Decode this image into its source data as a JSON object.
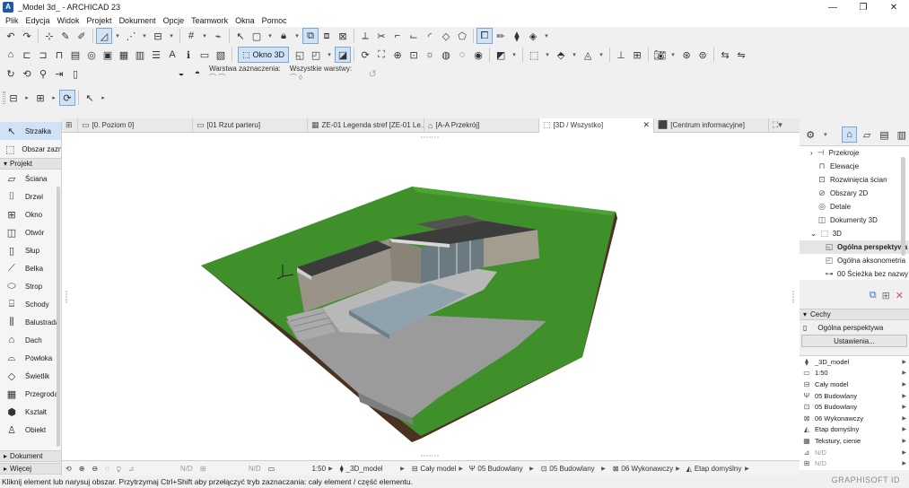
{
  "window": {
    "title": "_Model 3d_ - ARCHICAD 23",
    "app_icon": "archicad-logo"
  },
  "menu": [
    "Plik",
    "Edycja",
    "Widok",
    "Projekt",
    "Dokument",
    "Opcje",
    "Teamwork",
    "Okna",
    "Pomoc"
  ],
  "toolbar": {
    "window3d_label": "Okno 3D"
  },
  "infobox": {
    "layer_sel_label": "Warstwa zaznaczenia:",
    "all_layers_label": "Wszystkie warstwy:"
  },
  "toolbox": {
    "top": [
      {
        "label": "Strzałka",
        "icon": "arrow-icon",
        "selected": true
      },
      {
        "label": "Obszar zazn",
        "icon": "marquee-icon",
        "selected": false
      }
    ],
    "project_header": "Projekt",
    "project_tools": [
      {
        "label": "Ściana",
        "icon": "wall-icon"
      },
      {
        "label": "Drzwi",
        "icon": "door-icon"
      },
      {
        "label": "Okno",
        "icon": "window-icon"
      },
      {
        "label": "Otwór",
        "icon": "opening-icon"
      },
      {
        "label": "Słup",
        "icon": "column-icon"
      },
      {
        "label": "Belka",
        "icon": "beam-icon"
      },
      {
        "label": "Strop",
        "icon": "slab-icon"
      },
      {
        "label": "Schody",
        "icon": "stair-icon"
      },
      {
        "label": "Balustrada",
        "icon": "railing-icon"
      },
      {
        "label": "Dach",
        "icon": "roof-icon"
      },
      {
        "label": "Powłoka",
        "icon": "shell-icon"
      },
      {
        "label": "Świetlik",
        "icon": "skylight-icon"
      },
      {
        "label": "Przegroda",
        "icon": "curtain-wall-icon"
      },
      {
        "label": "Kształt",
        "icon": "morph-icon"
      },
      {
        "label": "Obiekt",
        "icon": "object-icon"
      }
    ],
    "document_header": "Dokument",
    "more_header": "Więcej"
  },
  "tabs": [
    {
      "label": "[0. Poziom 0]",
      "icon": "floorplan-icon",
      "active": false
    },
    {
      "label": "[01 Rzut parteru]",
      "icon": "layout-icon",
      "active": false
    },
    {
      "label": "ZE-01 Legenda stref [ZE-01 Le...",
      "icon": "schedule-icon",
      "active": false
    },
    {
      "label": "[A-A Przekrój]",
      "icon": "section-icon",
      "active": false
    },
    {
      "label": "[3D / Wszystko]",
      "icon": "3d-icon",
      "active": true
    },
    {
      "label": "[Centrum informacyjne]",
      "icon": "info-icon",
      "active": false
    }
  ],
  "viewport_status": {
    "nd1": "N/D",
    "nd2": "N/D",
    "scale": "1:50",
    "layer_combo": "_3D_model",
    "model_view": "Cały model",
    "pen_set": "05 Budowlany",
    "mvo": "05 Budowlany",
    "graphic_override": "06 Wykonawczy",
    "renovation": "Etap domyślny"
  },
  "navigator": {
    "items": [
      {
        "label": "Przekroje",
        "icon": "section-icon",
        "indent": 1,
        "expander": true
      },
      {
        "label": "Elewacje",
        "icon": "elevation-icon",
        "indent": 1
      },
      {
        "label": "Rozwinięcia ścian",
        "icon": "interior-elev-icon",
        "indent": 1
      },
      {
        "label": "Obszary 2D",
        "icon": "worksheet-icon",
        "indent": 1
      },
      {
        "label": "Detale",
        "icon": "detail-icon",
        "indent": 1
      },
      {
        "label": "Dokumenty 3D",
        "icon": "document3d-icon",
        "indent": 1
      },
      {
        "label": "3D",
        "icon": "3d-icon",
        "indent": 0,
        "expander": true,
        "expanded": true
      },
      {
        "label": "Ogólna perspektywa",
        "icon": "perspective-icon",
        "indent": 2,
        "selected": true
      },
      {
        "label": "Ogólna aksonometria",
        "icon": "axonometry-icon",
        "indent": 2
      },
      {
        "label": "00 Ścieżka bez nazwy",
        "icon": "path-icon",
        "indent": 2
      }
    ]
  },
  "properties": {
    "header": "Cechy",
    "name": "Ogólna perspektywa",
    "settings_button": "Ustawienia...",
    "rows": [
      {
        "label": "_3D_model",
        "icon": "layer-icon",
        "gray": false
      },
      {
        "label": "1:50",
        "icon": "scale-icon",
        "gray": false
      },
      {
        "label": "Cały model",
        "icon": "structure-icon",
        "gray": false
      },
      {
        "label": "05 Budowlany",
        "icon": "pen-icon",
        "gray": false
      },
      {
        "label": "05 Budowlany",
        "icon": "mvo-icon",
        "gray": false
      },
      {
        "label": "06 Wykonawczy",
        "icon": "override-icon",
        "gray": false
      },
      {
        "label": "Etap domyślny",
        "icon": "renovation-icon",
        "gray": false
      },
      {
        "label": "Tekstury, cienie",
        "icon": "render-icon",
        "gray": false
      },
      {
        "label": "N/D",
        "icon": "dimension-icon",
        "gray": true
      },
      {
        "label": "N/D",
        "icon": "zoom-icon",
        "gray": true
      }
    ]
  },
  "brand": "GRAPHISOFT ID",
  "status_text": "Kliknij element lub narysuj obszar. Przytrzymaj Ctrl+Shift aby przełączyć tryb zaznaczania: cały element / część elementu.",
  "colors": {
    "grass": "#3f8f2a",
    "soil": "#4a3222",
    "concrete": "#9b9b9b",
    "water": "#8fa2ad",
    "selection": "#cfe2f6"
  }
}
